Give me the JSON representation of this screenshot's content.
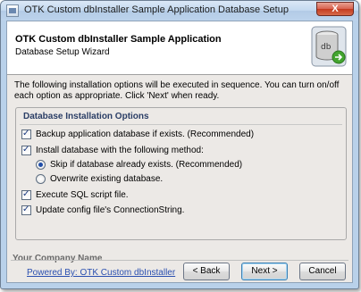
{
  "window": {
    "title": "OTK Custom dbInstaller Sample Application Database Setup",
    "close_label": "X"
  },
  "header": {
    "title": "OTK Custom dbInstaller Sample Application",
    "subtitle": "Database Setup Wizard",
    "icon_text": "db"
  },
  "intro": "The following installation options will be executed in sequence. You can turn on/off each option as appropriate. Click 'Next' when ready.",
  "options_group": {
    "title": "Database Installation Options",
    "items": [
      {
        "label": "Backup application database if exists. (Recommended)",
        "type": "checkbox",
        "checked": true
      },
      {
        "label": "Install database with the following method:",
        "type": "checkbox",
        "checked": true
      },
      {
        "label": "Skip if database already exists. (Recommended)",
        "type": "radio",
        "checked": true
      },
      {
        "label": "Overwrite existing database.",
        "type": "radio",
        "checked": false
      },
      {
        "label": "Execute SQL script file.",
        "type": "checkbox",
        "checked": true
      },
      {
        "label": "Update config file's ConnectionString.",
        "type": "checkbox",
        "checked": true
      }
    ]
  },
  "footer": {
    "company": "Your Company Name",
    "powered_by": "Powered By: OTK Custom dbInstaller",
    "back_label": "< Back",
    "next_label": "Next >",
    "cancel_label": "Cancel"
  },
  "colors": {
    "title_bar": "#c2d8ef",
    "close_button": "#c43a1f",
    "link": "#2a4fb0",
    "group_title": "#2b3e66"
  }
}
